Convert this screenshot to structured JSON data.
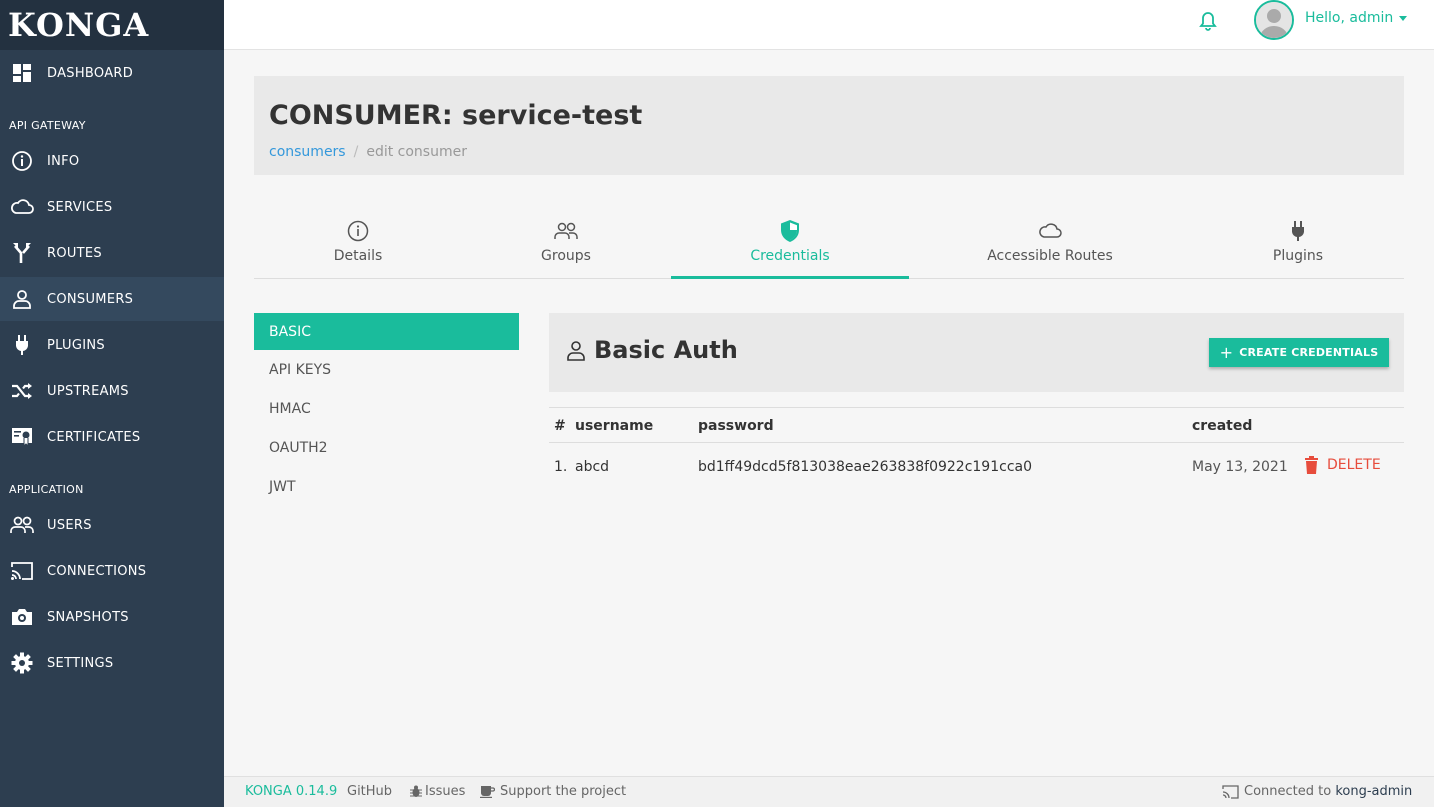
{
  "app": {
    "logo": "KONGA"
  },
  "sidebar": {
    "dashboard": "DASHBOARD",
    "section_api": "API GATEWAY",
    "info": "INFO",
    "services": "SERVICES",
    "routes": "ROUTES",
    "consumers": "CONSUMERS",
    "plugins": "PLUGINS",
    "upstreams": "UPSTREAMS",
    "certificates": "CERTIFICATES",
    "section_app": "APPLICATION",
    "users": "USERS",
    "connections": "CONNECTIONS",
    "snapshots": "SNAPSHOTS",
    "settings": "SETTINGS"
  },
  "topbar": {
    "greeting": "Hello, admin"
  },
  "header": {
    "title": "CONSUMER: service-test",
    "breadcrumb_link": "consumers",
    "breadcrumb_sep": "/",
    "breadcrumb_current": "edit consumer"
  },
  "tabs": {
    "details": "Details",
    "groups": "Groups",
    "credentials": "Credentials",
    "accessible_routes": "Accessible Routes",
    "plugins": "Plugins"
  },
  "cred_menu": {
    "basic": "BASIC",
    "api_keys": "API KEYS",
    "hmac": "HMAC",
    "oauth2": "OAUTH2",
    "jwt": "JWT"
  },
  "auth": {
    "title": "Basic Auth",
    "create_label": "CREATE CREDENTIALS"
  },
  "table": {
    "headers": {
      "num": "#",
      "username": "username",
      "password": "password",
      "created": "created"
    },
    "rows": [
      {
        "num": "1.",
        "username": "abcd",
        "password": "bd1ff49dcd5f813038eae263838f0922c191cca0",
        "created": "May 13, 2021",
        "action": "DELETE"
      }
    ]
  },
  "footer": {
    "version": "KONGA 0.14.9",
    "github": "GitHub",
    "issues": "Issues",
    "support": "Support the project",
    "connected_prefix": "Connected to",
    "connection": "kong-admin"
  },
  "colors": {
    "accent": "#1abc9c",
    "sidebar": "#2d3e50",
    "danger": "#e74c3c",
    "link": "#3498db"
  }
}
